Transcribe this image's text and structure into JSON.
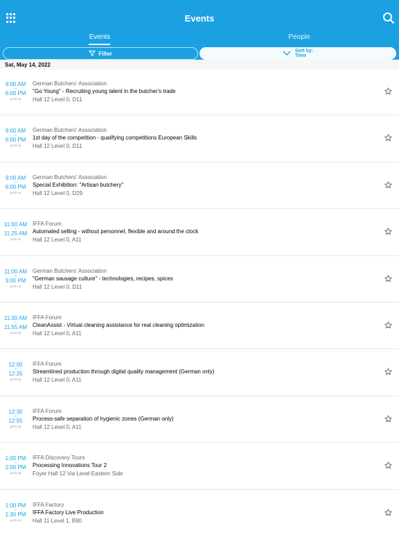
{
  "app": {
    "title": "Events",
    "grid_icon": "grid-menu-icon",
    "search_icon": "search-icon",
    "accent_color": "#1ba1e2"
  },
  "tabs": [
    {
      "label": "Events",
      "active": true
    },
    {
      "label": "People",
      "active": false
    }
  ],
  "actions": {
    "filter_label": "Filter",
    "filter_icon": "funnel-icon",
    "sort_label": "Sort by:",
    "sort_value": "Time",
    "sort_icon": "chevron-down-icon"
  },
  "date_header": "Sat, May 14, 2022",
  "events": [
    {
      "start": "9:00 AM",
      "end": "6:00 PM",
      "tz": "(UTC+2)",
      "org": "German Butchers' Association",
      "title": "\"Go Young\" - Recruiting young talent in the butcher's trade",
      "location": "Hall 12 Level 0, D11",
      "starred": false
    },
    {
      "start": "9:00 AM",
      "end": "6:00 PM",
      "tz": "(UTC+2)",
      "org": "German Butchers' Association",
      "title": "1st day of the competition - qualifying competitions European Skills",
      "location": "Hall 12 Level 0, D11",
      "starred": false
    },
    {
      "start": "9:00 AM",
      "end": "6:00 PM",
      "tz": "(UTC+2)",
      "org": "German Butchers' Association",
      "title": "Special Exhibition: \"Artisan butchery\"",
      "location": "Hall 12 Level 0, D29",
      "starred": false
    },
    {
      "start": "11:00 AM",
      "end": "11:25 AM",
      "tz": "(UTC+2)",
      "org": "IFFA Forum",
      "title": "Automated selling - without personnel, flexible and around the clock",
      "location": "Hall 12 Level 0, A11",
      "starred": false
    },
    {
      "start": "11:00 AM",
      "end": "3:00 PM",
      "tz": "(UTC+2)",
      "org": "German Butchers' Association",
      "title": "\"German sausage culture\" - technologies, recipes, spices",
      "location": "Hall 12 Level 0, D11",
      "starred": false
    },
    {
      "start": "11:30 AM",
      "end": "11:55 AM",
      "tz": "(UTC+2)",
      "org": "IFFA Forum",
      "title": "CleanAssist - Virtual cleaning assistance for real cleaning optimization",
      "location": "Hall 12 Level 0, A11",
      "starred": false
    },
    {
      "start": "12:00",
      "end": "12:25",
      "tz": "(UTC+2)",
      "org": "IFFA Forum",
      "title": "Streamlined production through digital quality management (German only)",
      "location": "Hall 12 Level 0, A11",
      "starred": false
    },
    {
      "start": "12:30",
      "end": "12:55",
      "tz": "(UTC+2)",
      "org": "IFFA Forum",
      "title": "Process-safe separation of hygienic zones (German only)",
      "location": "Hall 12 Level 0, A11",
      "starred": false
    },
    {
      "start": "1:00 PM",
      "end": "2:00 PM",
      "tz": "(UTC+2)",
      "org": "IFFA Discovery Tours",
      "title": "Processing Innovations Tour 2",
      "location": "Foyer Hall 12 Via Level Eastern Side",
      "starred": false
    },
    {
      "start": "1:00 PM",
      "end": "1:30 PM",
      "tz": "(UTC+2)",
      "org": "IFFA Factory",
      "title": "IFFA Factory Live Production",
      "location": "Hall 11 Level 1, B90",
      "starred": false
    }
  ]
}
